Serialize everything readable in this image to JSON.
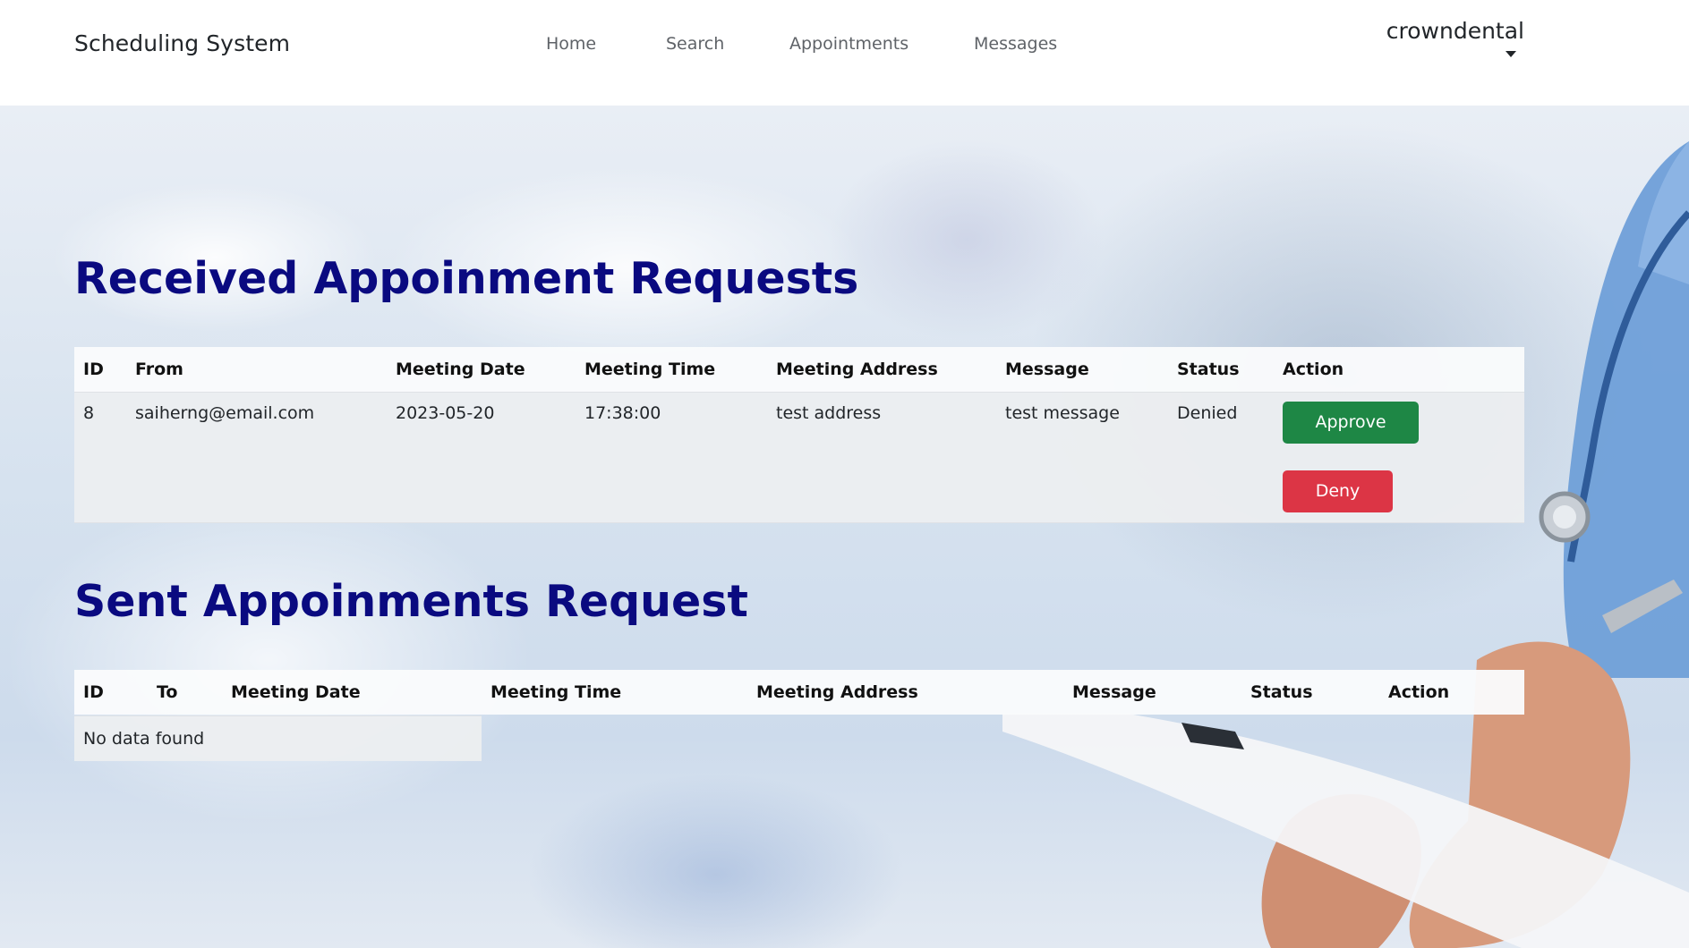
{
  "navbar": {
    "brand": "Scheduling System",
    "links": [
      {
        "label": "Home"
      },
      {
        "label": "Search"
      },
      {
        "label": "Appointments"
      },
      {
        "label": "Messages"
      }
    ],
    "user": "crowndental"
  },
  "received": {
    "title": "Received Appoinment Requests",
    "columns": [
      "ID",
      "From",
      "Meeting Date",
      "Meeting Time",
      "Meeting Address",
      "Message",
      "Status",
      "Action"
    ],
    "rows": [
      {
        "id": "8",
        "from": "saiherng@email.com",
        "date": "2023-05-20",
        "time": "17:38:00",
        "address": "test address",
        "message": "test message",
        "status": "Denied",
        "approve_label": "Approve",
        "deny_label": "Deny"
      }
    ]
  },
  "sent": {
    "title": "Sent Appoinments Request",
    "columns": [
      "ID",
      "To",
      "Meeting Date",
      "Meeting Time",
      "Meeting Address",
      "Message",
      "Status",
      "Action"
    ],
    "empty_text": "No data found"
  },
  "colors": {
    "title": "#0a0a80",
    "approve": "#1e8745",
    "deny": "#dc3545"
  }
}
